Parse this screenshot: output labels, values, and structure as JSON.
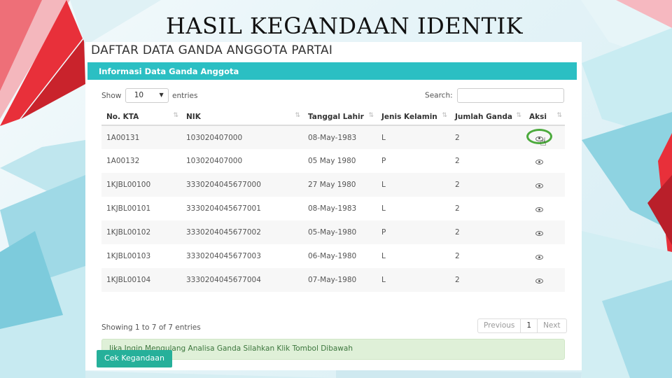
{
  "slide": {
    "title": "HASIL KEGANDAAN IDENTIK"
  },
  "panel": {
    "heading": "DAFTAR DATA GANDA ANGGOTA PARTAI",
    "card_title": "Informasi Data Ganda Anggota",
    "show_label": "Show",
    "entries_value": "10",
    "entries_label": "entries",
    "search_label": "Search:",
    "columns": [
      "No. KTA",
      "NIK",
      "Tanggal Lahir",
      "Jenis Kelamin",
      "Jumlah Ganda",
      "Aksi"
    ],
    "rows": [
      {
        "kta": "1A00131",
        "nik": "103020407000",
        "tgl": "08-May-1983",
        "jk": "L",
        "jml": "2"
      },
      {
        "kta": "1A00132",
        "nik": "103020407000",
        "tgl": "05 May 1980",
        "jk": "P",
        "jml": "2"
      },
      {
        "kta": "1KJBL00100",
        "nik": "3330204045677000",
        "tgl": "27 May 1980",
        "jk": "L",
        "jml": "2"
      },
      {
        "kta": "1KJBL00101",
        "nik": "3330204045677001",
        "tgl": "08-May-1983",
        "jk": "L",
        "jml": "2"
      },
      {
        "kta": "1KJBL00102",
        "nik": "3330204045677002",
        "tgl": "05-May-1980",
        "jk": "P",
        "jml": "2"
      },
      {
        "kta": "1KJBL00103",
        "nik": "3330204045677003",
        "tgl": "06-May-1980",
        "jk": "L",
        "jml": "2"
      },
      {
        "kta": "1KJBL00104",
        "nik": "3330204045677004",
        "tgl": "07-May-1980",
        "jk": "L",
        "jml": "2"
      }
    ],
    "info": "Showing 1 to 7 of 7 entries",
    "pager": {
      "prev": "Previous",
      "page": "1",
      "next": "Next"
    },
    "alert": "Jika Ingin Mengulang Analisa Ganda Silahkan Klik Tombol Dibawah",
    "button": "Cek Kegandaan"
  },
  "colors": {
    "header": "#2bbfc3",
    "button": "#26b09a",
    "alert_bg": "#dff0d8",
    "highlight_ring": "#4caa3d",
    "accent_red": "#e8303a"
  },
  "icons": {
    "view": "eye-icon",
    "sort": "sort-icon"
  }
}
